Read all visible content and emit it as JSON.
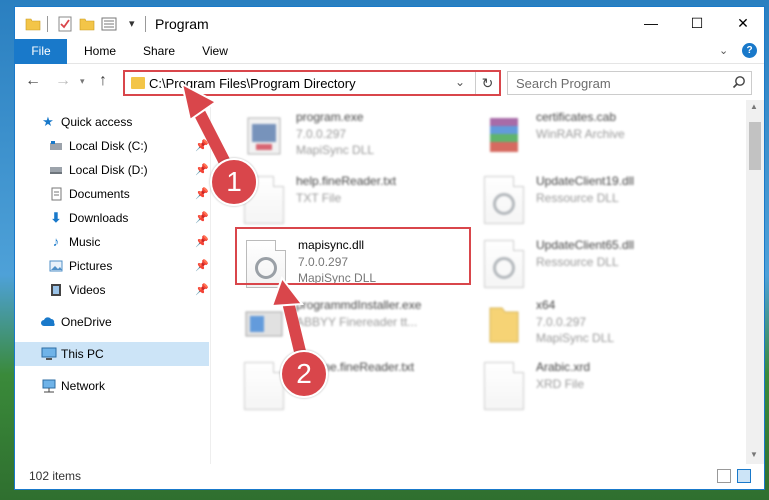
{
  "window": {
    "title": "Program",
    "controls": {
      "minimize": "—",
      "maximize": "☐",
      "close": "✕"
    }
  },
  "ribbon": {
    "tabs": [
      "File",
      "Home",
      "Share",
      "View"
    ]
  },
  "address": {
    "path": "C:\\Program Files\\Program Directory"
  },
  "search": {
    "placeholder": "Search Program"
  },
  "sidebar": {
    "items": [
      {
        "label": "Quick access",
        "icon": "star-icon"
      },
      {
        "label": "Local Disk (C:)",
        "icon": "drive-icon",
        "pinned": true
      },
      {
        "label": "Local Disk (D:)",
        "icon": "drive-icon",
        "pinned": true
      },
      {
        "label": "Documents",
        "icon": "documents-icon",
        "pinned": true
      },
      {
        "label": "Downloads",
        "icon": "downloads-icon",
        "pinned": true
      },
      {
        "label": "Music",
        "icon": "music-icon",
        "pinned": true
      },
      {
        "label": "Pictures",
        "icon": "pictures-icon",
        "pinned": true
      },
      {
        "label": "Videos",
        "icon": "videos-icon",
        "pinned": true
      },
      {
        "label": "OneDrive",
        "icon": "cloud-icon"
      },
      {
        "label": "This PC",
        "icon": "computer-icon",
        "selected": true
      },
      {
        "label": "Network",
        "icon": "network-icon"
      }
    ]
  },
  "files": [
    {
      "name": "program.exe",
      "version": "7.0.0.297",
      "type": "MapiSync DLL",
      "icon": "program-exe-icon"
    },
    {
      "name": "certificates.cab",
      "version": "",
      "type": "WinRAR Archive",
      "icon": "winrar-icon"
    },
    {
      "name": "help.fineReader.txt",
      "version": "",
      "type": "TXT File",
      "icon": "text-file-icon"
    },
    {
      "name": "UpdateClient19.dll",
      "version": "",
      "type": "Ressource DLL",
      "icon": "dll-gear-icon"
    },
    {
      "name": "mapisync.dll",
      "version": "7.0.0.297",
      "type": "MapiSync DLL",
      "icon": "dll-gear-icon"
    },
    {
      "name": "UpdateClient65.dll",
      "version": "",
      "type": "Ressource DLL",
      "icon": "dll-gear-icon"
    },
    {
      "name": "programmdInstaller.exe",
      "version": "",
      "type": "ABBYY Finereader tt...",
      "icon": "installer-icon"
    },
    {
      "name": "x64",
      "version": "7.0.0.297",
      "type": "MapiSync DLL",
      "icon": "folder-icon"
    },
    {
      "name": "readme.fineReader.txt",
      "version": "",
      "type": "",
      "icon": "text-file-icon"
    },
    {
      "name": "Arabic.xrd",
      "version": "",
      "type": "XRD File",
      "icon": "text-file-icon"
    }
  ],
  "status": {
    "item_count": "102 items"
  },
  "annotations": {
    "steps": [
      "1",
      "2"
    ],
    "color": "#d9464b"
  }
}
